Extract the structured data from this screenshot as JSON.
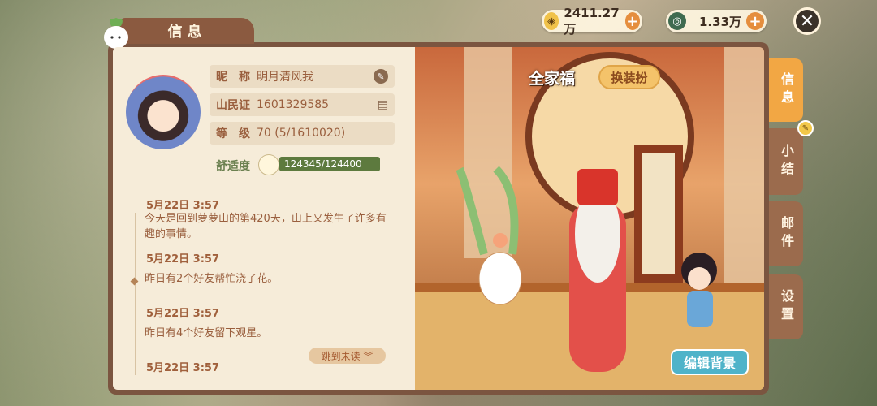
{
  "currencies": [
    {
      "icon": "coin-icon",
      "value": "2411.27万"
    },
    {
      "icon": "jade-icon",
      "value": "1.33万"
    }
  ],
  "title": "信息",
  "profile": {
    "nickname_label": "昵　称",
    "nickname": "明月清风我",
    "id_label": "山民证",
    "id": "1601329585",
    "level_label": "等　级",
    "level": "70 (5/1610020)",
    "comfort_label": "舒适度",
    "comfort_value": "124345/124400",
    "comfort_ratio": 0.9996
  },
  "log": [
    {
      "time": "5月22日 3:57",
      "text": "今天是回到萝萝山的第420天，山上又发生了许多有趣的事情。"
    },
    {
      "time": "5月22日 3:57",
      "text": "昨日有2个好友帮忙浇了花。"
    },
    {
      "time": "5月22日 3:57",
      "text": "昨日有4个好友留下观星。"
    },
    {
      "time": "5月22日 3:57",
      "text": ""
    }
  ],
  "jump_unread": "跳到未读",
  "scene": {
    "title": "全家福",
    "outfit_button": "换装扮",
    "edit_bg_button": "编辑背景"
  },
  "tabs": [
    "信息",
    "小结",
    "邮件",
    "设置"
  ]
}
